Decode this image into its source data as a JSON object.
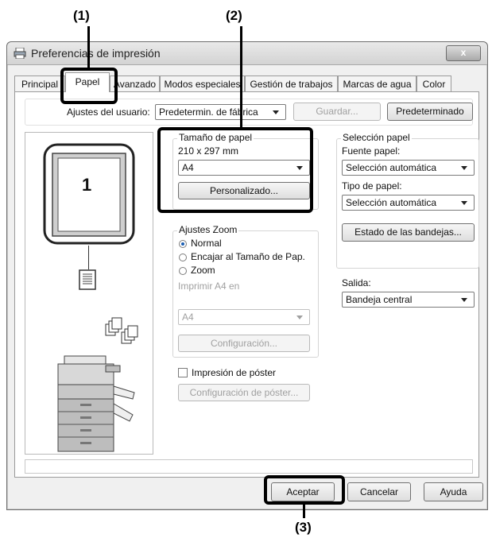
{
  "callouts": [
    "(1)",
    "(2)",
    "(3)"
  ],
  "window": {
    "title": "Preferencias de impresión",
    "close_symbol": "x"
  },
  "tabs": [
    {
      "label": "Principal",
      "active": false
    },
    {
      "label": "Papel",
      "active": true
    },
    {
      "label": "Avanzado",
      "active": false
    },
    {
      "label": "Modos especiales",
      "active": false
    },
    {
      "label": "Gestión de trabajos",
      "active": false
    },
    {
      "label": "Marcas de agua",
      "active": false
    },
    {
      "label": "Color",
      "active": false
    }
  ],
  "user_settings": {
    "label": "Ajustes del usuario:",
    "value": "Predetermin. de fábrica",
    "save_button": "Guardar...",
    "default_button": "Predeterminado"
  },
  "preview": {
    "page_number": "1"
  },
  "paper_size": {
    "group_label": "Tamaño de papel",
    "dimensions": "210 x 297 mm",
    "value": "A4",
    "custom_button": "Personalizado..."
  },
  "zoom": {
    "group_label": "Ajustes Zoom",
    "options": [
      "Normal",
      "Encajar al Tamaño de Pap.",
      "Zoom"
    ],
    "selected": "Normal",
    "print_on_label": "Imprimir A4 en",
    "print_on_value": "A4",
    "config_button": "Configuración..."
  },
  "poster": {
    "checkbox_label": "Impresión de póster",
    "config_button": "Configuración de póster..."
  },
  "paper_selection": {
    "group_label": "Selección papel",
    "source_label": "Fuente papel:",
    "source_value": "Selección automática",
    "type_label": "Tipo de papel:",
    "type_value": "Selección automática",
    "tray_status_button": "Estado de las bandejas..."
  },
  "output": {
    "label": "Salida:",
    "value": "Bandeja central"
  },
  "footer": {
    "ok": "Aceptar",
    "cancel": "Cancelar",
    "help": "Ayuda"
  }
}
